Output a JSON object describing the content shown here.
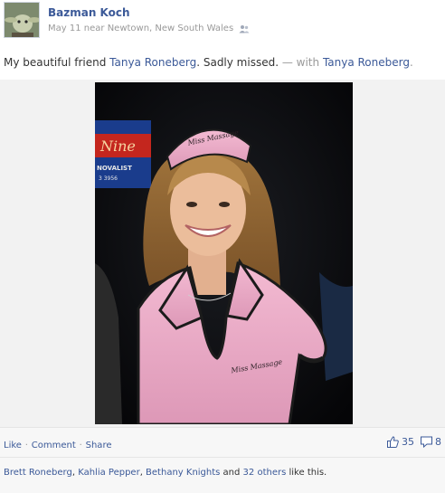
{
  "post": {
    "author": "Bazman Koch",
    "date": "May 11",
    "location_prefix": "near",
    "location": "Newtown, New South Wales",
    "audience_icon": "friends-icon",
    "text_prefix": "My beautiful friend ",
    "mention": "Tanya Roneberg",
    "text_suffix": ". Sadly missed.",
    "with_label": " — with ",
    "with_name": "Tanya Roneberg",
    "with_end": "."
  },
  "photo": {
    "sign_text": "Nine",
    "sign_sub": "NOVALIST",
    "sign_num": "3 3956",
    "cap_text": "Miss Massage",
    "shirt_text": "Miss Massage"
  },
  "actions": {
    "like": "Like",
    "comment": "Comment",
    "share": "Share",
    "separator": "·",
    "like_count": "35",
    "comment_count": "8"
  },
  "likes": {
    "name1": "Brett Roneberg",
    "name2": "Kahlia Pepper",
    "name3": "Bethany Knights",
    "and": " and ",
    "others": "32 others",
    "suffix": " like this.",
    "comma": ", "
  },
  "colors": {
    "link": "#3b5998",
    "muted": "#999999",
    "shirt_pink": "#f0b2cc",
    "background_dark": "#111111"
  }
}
